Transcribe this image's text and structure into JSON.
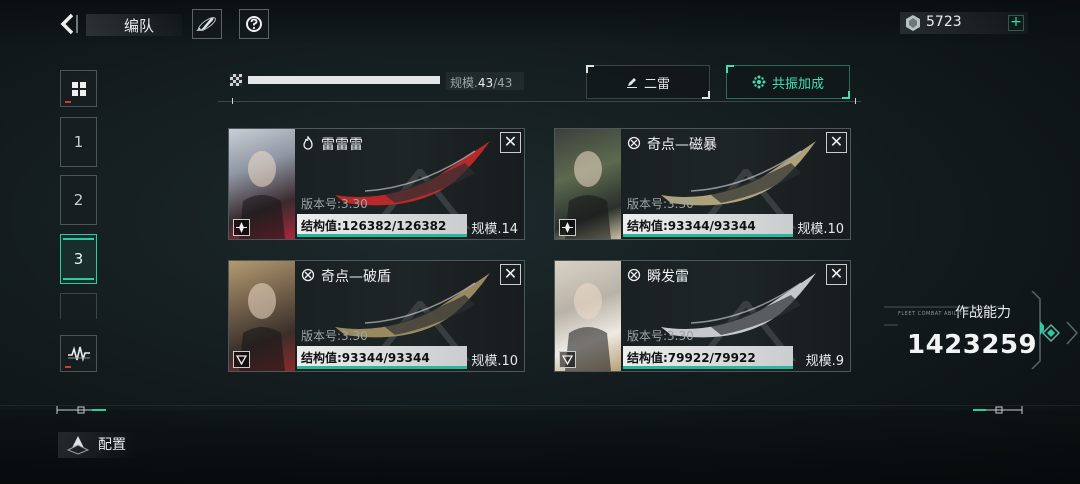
{
  "header": {
    "title": "编队",
    "resource_value": "5723",
    "plus_label": "+"
  },
  "left_nav": {
    "tabs": [
      {
        "label": "1",
        "active": false
      },
      {
        "label": "2",
        "active": false
      },
      {
        "label": "3",
        "active": true
      }
    ]
  },
  "fleet_scale": {
    "label": "规模.",
    "current": "43",
    "max": "/43",
    "fill_fraction": 1.0
  },
  "buttons": {
    "edit_label": "二雷",
    "resonance_label": "共振加成"
  },
  "ships": [
    {
      "name": "雷雷雷",
      "type_icon": "fire-icon",
      "version": "版本号:3.30",
      "structure": "结构值:126382/126382",
      "structure_fraction": 1.0,
      "scale": "规模.14",
      "ship_color": "#d42a2a"
    },
    {
      "name": "奇点—磁暴",
      "type_icon": "target-icon",
      "version": "版本号:3.30",
      "structure": "结构值:93344/93344",
      "structure_fraction": 1.0,
      "scale": "规模.10",
      "ship_color": "#c8b98a"
    },
    {
      "name": "奇点—破盾",
      "type_icon": "target-icon",
      "version": "版本号:3.30",
      "structure": "结构值:93344/93344",
      "structure_fraction": 1.0,
      "scale": "规模.10",
      "ship_color": "#b09a6a"
    },
    {
      "name": "瞬发雷",
      "type_icon": "target-icon",
      "version": "版本号:3.30",
      "structure": "结构值:79922/79922",
      "structure_fraction": 1.0,
      "scale": "规模.9",
      "ship_color": "#e4e6e6"
    }
  ],
  "combat_power": {
    "label": "作战能力",
    "small_text": "FLEET COMBAT ABILITY",
    "value": "1423259"
  },
  "bottom": {
    "config_label": "配置"
  },
  "colors": {
    "accent": "#2fc9a4",
    "structure_bar": "#26b899"
  }
}
